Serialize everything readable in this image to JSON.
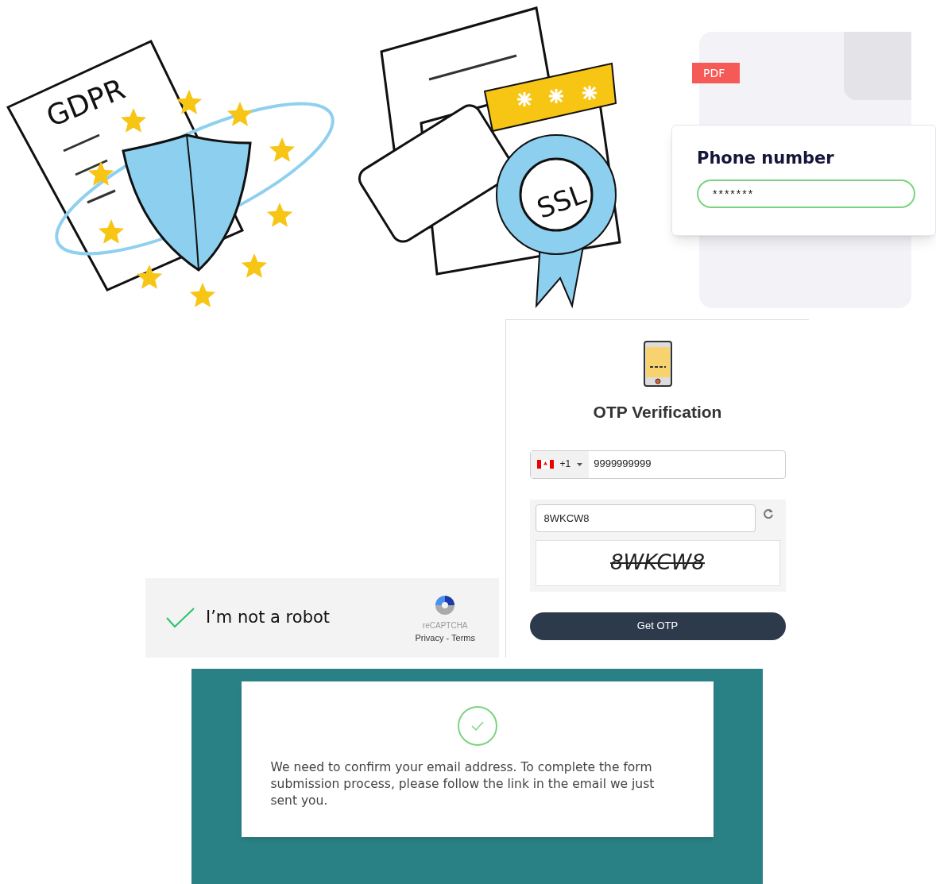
{
  "gdpr_illustration": {
    "label": "GDPR"
  },
  "ssl_illustration": {
    "label": "SSL"
  },
  "pdf_form": {
    "badge": "PDF",
    "field_label": "Phone number",
    "field_value": "*******"
  },
  "otp_card": {
    "title": "OTP Verification",
    "country_code": "+1",
    "phone_value": "9999999999",
    "captcha_value": "8WKCW8",
    "captcha_image_text": "8WKCW8",
    "button": "Get OTP"
  },
  "recaptcha": {
    "checked": true,
    "label": "I’m not a robot",
    "brand": "reCAPTCHA",
    "links": "Privacy - Terms"
  },
  "confirmation": {
    "message": "We need to confirm your email address. To complete the form submission process, please follow the link in the email we just sent you."
  }
}
